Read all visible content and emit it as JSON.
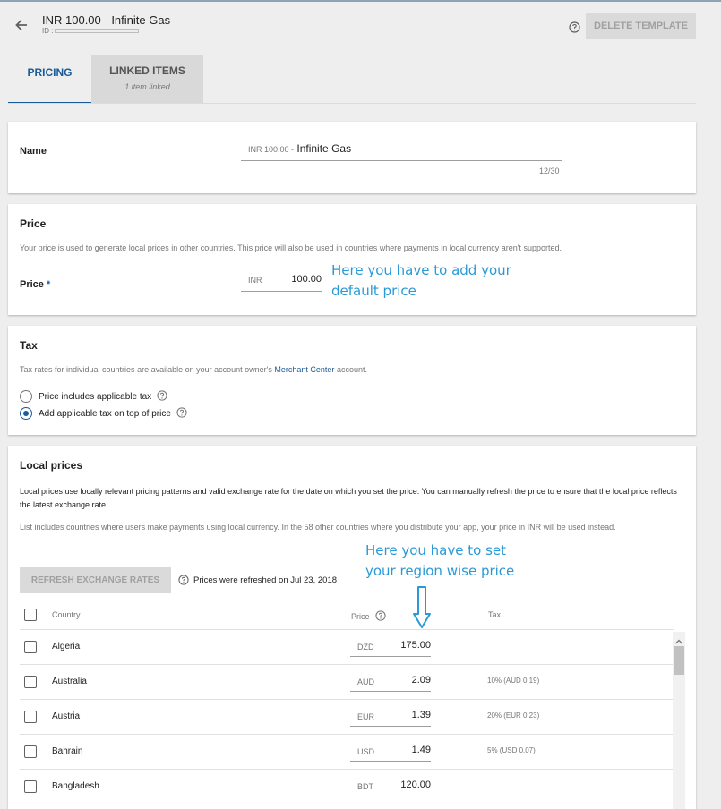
{
  "header": {
    "title": "INR 100.00 - Infinite Gas",
    "id_label": "ID :",
    "delete_label": "DELETE TEMPLATE"
  },
  "tabs": [
    {
      "label": "PRICING",
      "active": true
    },
    {
      "label": "LINKED ITEMS",
      "sub": "1 item linked",
      "active": false
    }
  ],
  "name_card": {
    "label": "Name",
    "prefix": "INR 100.00 -",
    "value": "Infinite Gas",
    "counter": "12/30"
  },
  "price_card": {
    "heading": "Price",
    "description": "Your price is used to generate local prices in other countries. This price will also be used in countries where payments in local currency aren't supported.",
    "label": "Price",
    "required_mark": "*",
    "currency": "INR",
    "value": "100.00",
    "annotation_line1": "Here you have to add your",
    "annotation_line2": "default price"
  },
  "tax_card": {
    "heading": "Tax",
    "desc_before": "Tax rates for individual countries are available on your account owner's",
    "desc_link": "Merchant Center",
    "desc_after": "account.",
    "option_includes": "Price includes applicable tax",
    "option_add": "Add applicable tax on top of price",
    "selected": "add"
  },
  "local_card": {
    "heading": "Local prices",
    "desc1": "Local prices use locally relevant pricing patterns and valid exchange rate for the date on which you set the price. You can manually refresh the price to ensure that the local price reflects the latest exchange rate.",
    "desc2": "List includes countries where users make payments using local currency. In the 58 other countries where you distribute your app, your price in INR will be used instead.",
    "refresh_label": "REFRESH EXCHANGE RATES",
    "refresh_info": "Prices were refreshed on Jul 23, 2018",
    "annotation_line1": "Here you have to set",
    "annotation_line2": "your region wise price",
    "columns": {
      "country": "Country",
      "price": "Price",
      "tax": "Tax"
    },
    "rows": [
      {
        "country": "Algeria",
        "currency": "DZD",
        "price": "175.00",
        "tax": ""
      },
      {
        "country": "Australia",
        "currency": "AUD",
        "price": "2.09",
        "tax": "10% (AUD 0.19)"
      },
      {
        "country": "Austria",
        "currency": "EUR",
        "price": "1.39",
        "tax": "20% (EUR 0.23)"
      },
      {
        "country": "Bahrain",
        "currency": "USD",
        "price": "1.49",
        "tax": "5% (USD 0.07)"
      },
      {
        "country": "Bangladesh",
        "currency": "BDT",
        "price": "120.00",
        "tax": ""
      }
    ]
  },
  "colors": {
    "accent": "#1a5a96",
    "annotation": "#2a9ad6",
    "background": "#eeeeee"
  }
}
